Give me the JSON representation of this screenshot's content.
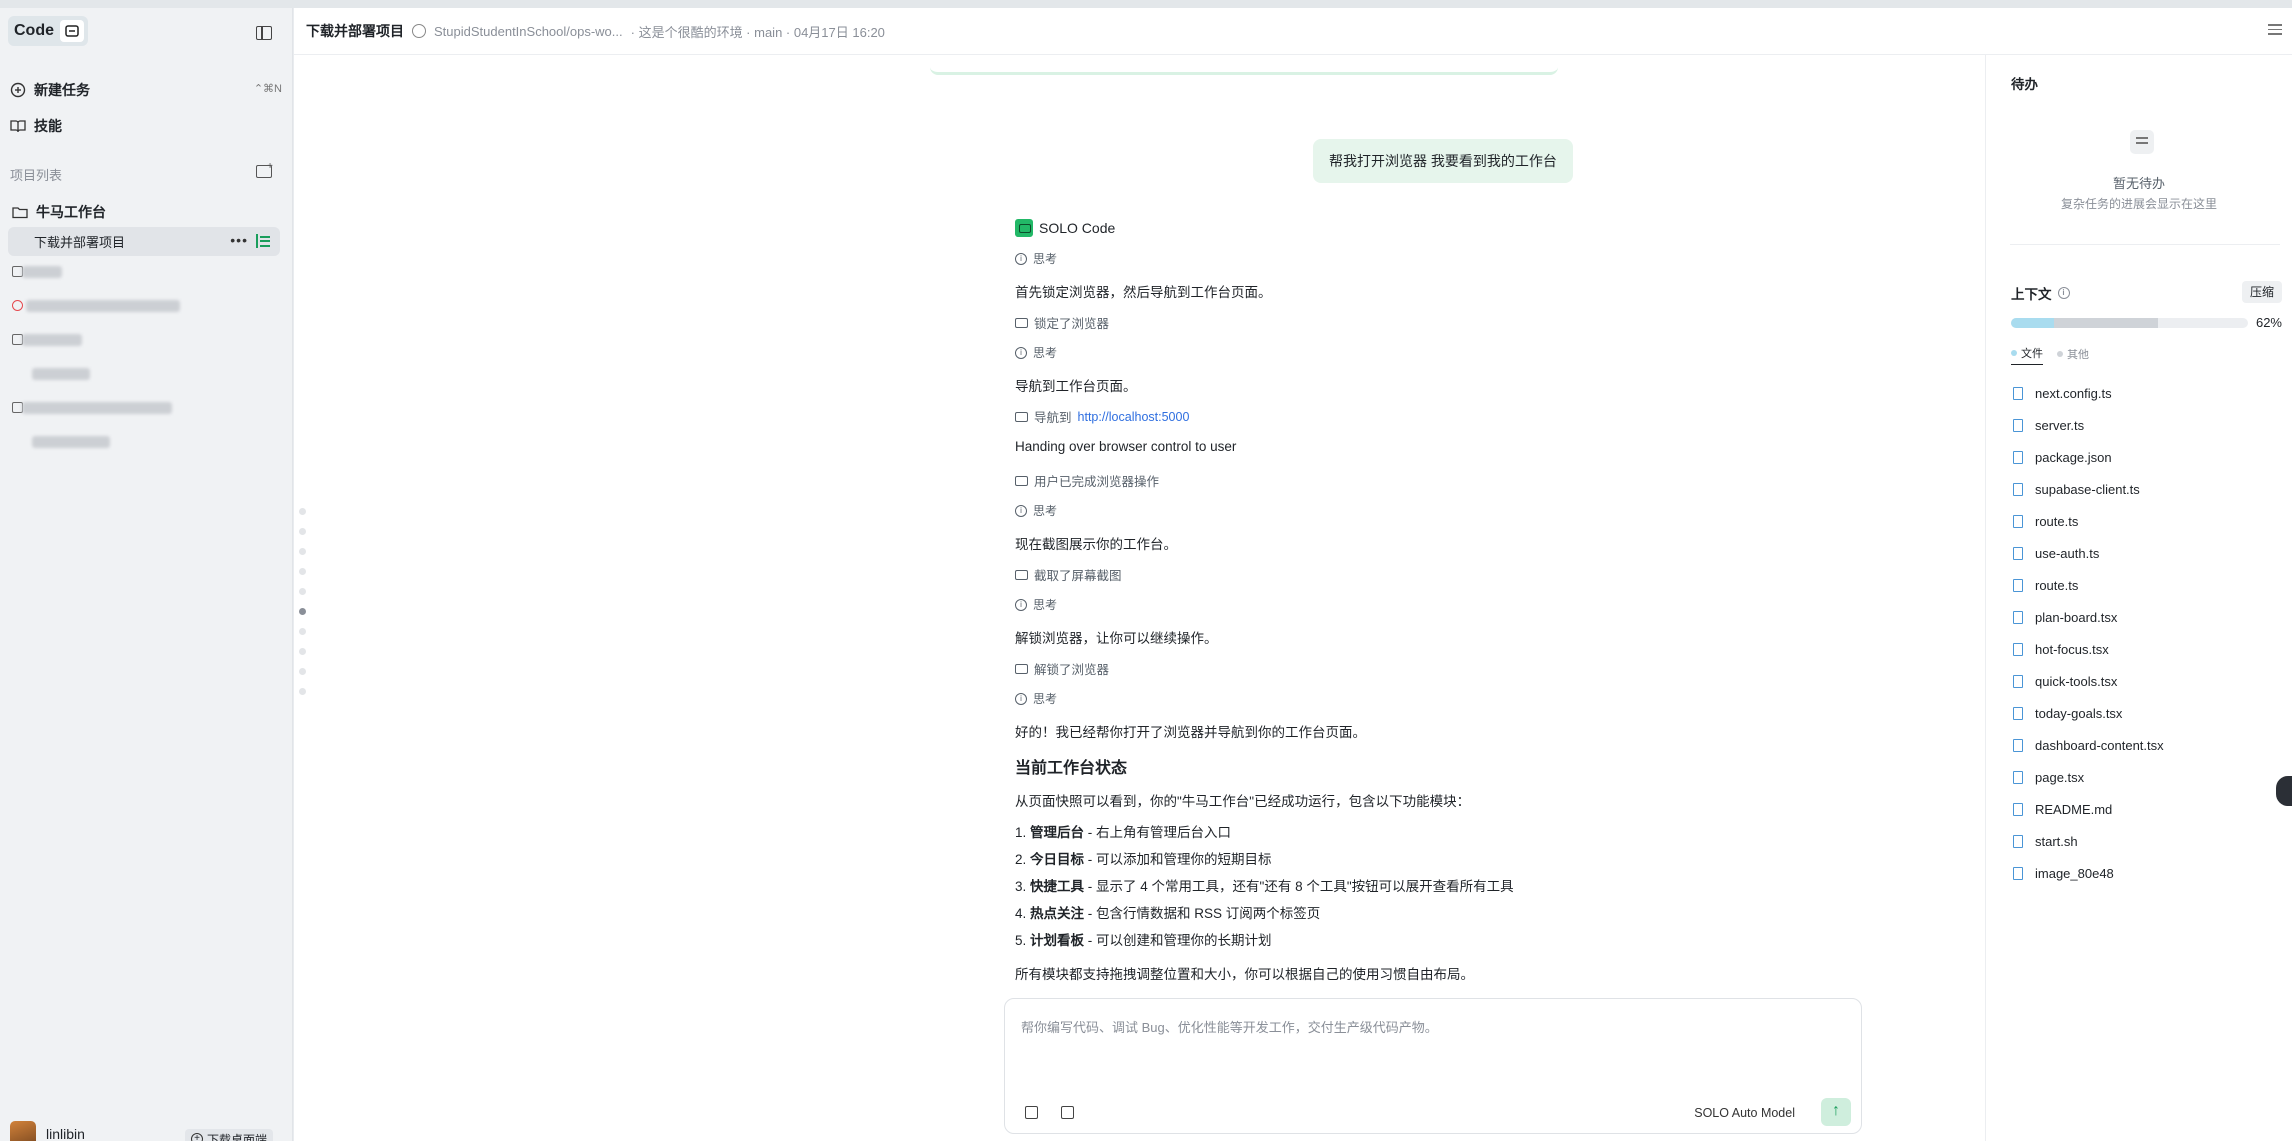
{
  "sidebar": {
    "brand": "Code",
    "new_task": "新建任务",
    "shortcut": "⌃⌘N",
    "skills": "技能",
    "section_label": "项目列表",
    "project": "牛马工作台",
    "active_task": "下载并部署项目",
    "user_name": "linlibin",
    "download_label": "下载桌面端"
  },
  "header": {
    "title": "下载并部署项目",
    "repo": "StupidStudentInSchool/ops-wo...",
    "meta": "· 这是个很酷的环境 · main · 04月17日 16:20"
  },
  "chat": {
    "user_message": "帮我打开浏览器 我要看到我的工作台",
    "agent_name": "SOLO Code",
    "think_label": "思考",
    "steps": {
      "t1": "首先锁定浏览器，然后导航到工作台页面。",
      "tool1": "锁定了浏览器",
      "t2": "导航到工作台页面。",
      "tool2_prefix": "导航到",
      "tool2_link": "http://localhost:5000",
      "handover": "Handing over browser control to user",
      "tool3": "用户已完成浏览器操作",
      "t3": "现在截图展示你的工作台。",
      "tool4": "截取了屏幕截图",
      "t4": "解锁浏览器，让你可以继续操作。",
      "tool5": "解锁了浏览器",
      "final": "好的！我已经帮你打开了浏览器并导航到你的工作台页面。"
    },
    "heading": "当前工作台状态",
    "intro": "从页面快照可以看到，你的\"牛马工作台\"已经成功运行，包含以下功能模块：",
    "list": [
      {
        "num": "1.",
        "bold": "管理后台",
        "text": " - 右上角有管理后台入口"
      },
      {
        "num": "2.",
        "bold": "今日目标",
        "text": " - 可以添加和管理你的短期目标"
      },
      {
        "num": "3.",
        "bold": "快捷工具",
        "text": " - 显示了 4 个常用工具，还有\"还有 8 个工具\"按钮可以展开查看所有工具"
      },
      {
        "num": "4.",
        "bold": "热点关注",
        "text": " - 包含行情数据和 RSS 订阅两个标签页"
      },
      {
        "num": "5.",
        "bold": "计划看板",
        "text": " - 可以创建和管理你的长期计划"
      }
    ],
    "outro": "所有模块都支持拖拽调整位置和大小，你可以根据自己的使用习惯自由布局。"
  },
  "composer": {
    "placeholder": "帮你编写代码、调试 Bug、优化性能等开发工作，交付生产级代码产物。",
    "model": "SOLO Auto Model",
    "send_glyph": "↑"
  },
  "panel": {
    "todo_title": "待办",
    "todo_empty": "暂无待办",
    "todo_empty_sub": "复杂任务的进展会显示在这里",
    "context_title": "上下文",
    "compress": "压缩",
    "percent": "62%",
    "usage": {
      "files_fraction": 0.18,
      "other_fraction": 0.44
    },
    "tab_files": "文件",
    "tab_other": "其他",
    "files": [
      "next.config.ts",
      "server.ts",
      "package.json",
      "supabase-client.ts",
      "route.ts",
      "use-auth.ts",
      "route.ts",
      "plan-board.tsx",
      "hot-focus.tsx",
      "quick-tools.tsx",
      "today-goals.tsx",
      "dashboard-content.tsx",
      "page.tsx",
      "README.md",
      "start.sh",
      "image_80e48"
    ]
  },
  "colors": {
    "accent_green": "#22b867",
    "link_blue": "#2f6fe0",
    "file_icon": "#4a95d6"
  }
}
